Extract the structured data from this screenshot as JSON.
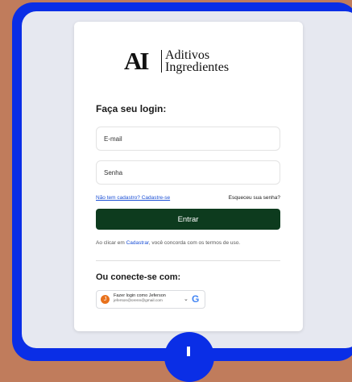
{
  "brand": {
    "mark": "AI",
    "line1": "Aditivos",
    "line2": "Ingredientes"
  },
  "login": {
    "title": "Faça seu login:",
    "email_placeholder": "E-mail",
    "password_placeholder": "Senha",
    "signup_link": "Não tem cadastro? Cadastre-se",
    "forgot_link": "Esqueceu sua senha?",
    "submit_label": "Entrar"
  },
  "terms": {
    "prefix": "Ao clicar em ",
    "link": "Cadastrar",
    "suffix": ", você concorda com os termos de uso."
  },
  "social": {
    "title": "Ou conecte-se com:",
    "google_name": "Fazer login como Jeferson",
    "google_email": "jeferson@orenn@gmail.com",
    "avatar_letter": "J",
    "google_icon": "G",
    "chevron_icon": "⌄"
  },
  "colors": {
    "frame": "#0a2ee6",
    "background": "#c07c5c",
    "button": "#0d3b1e",
    "link": "#1a4fd6"
  }
}
